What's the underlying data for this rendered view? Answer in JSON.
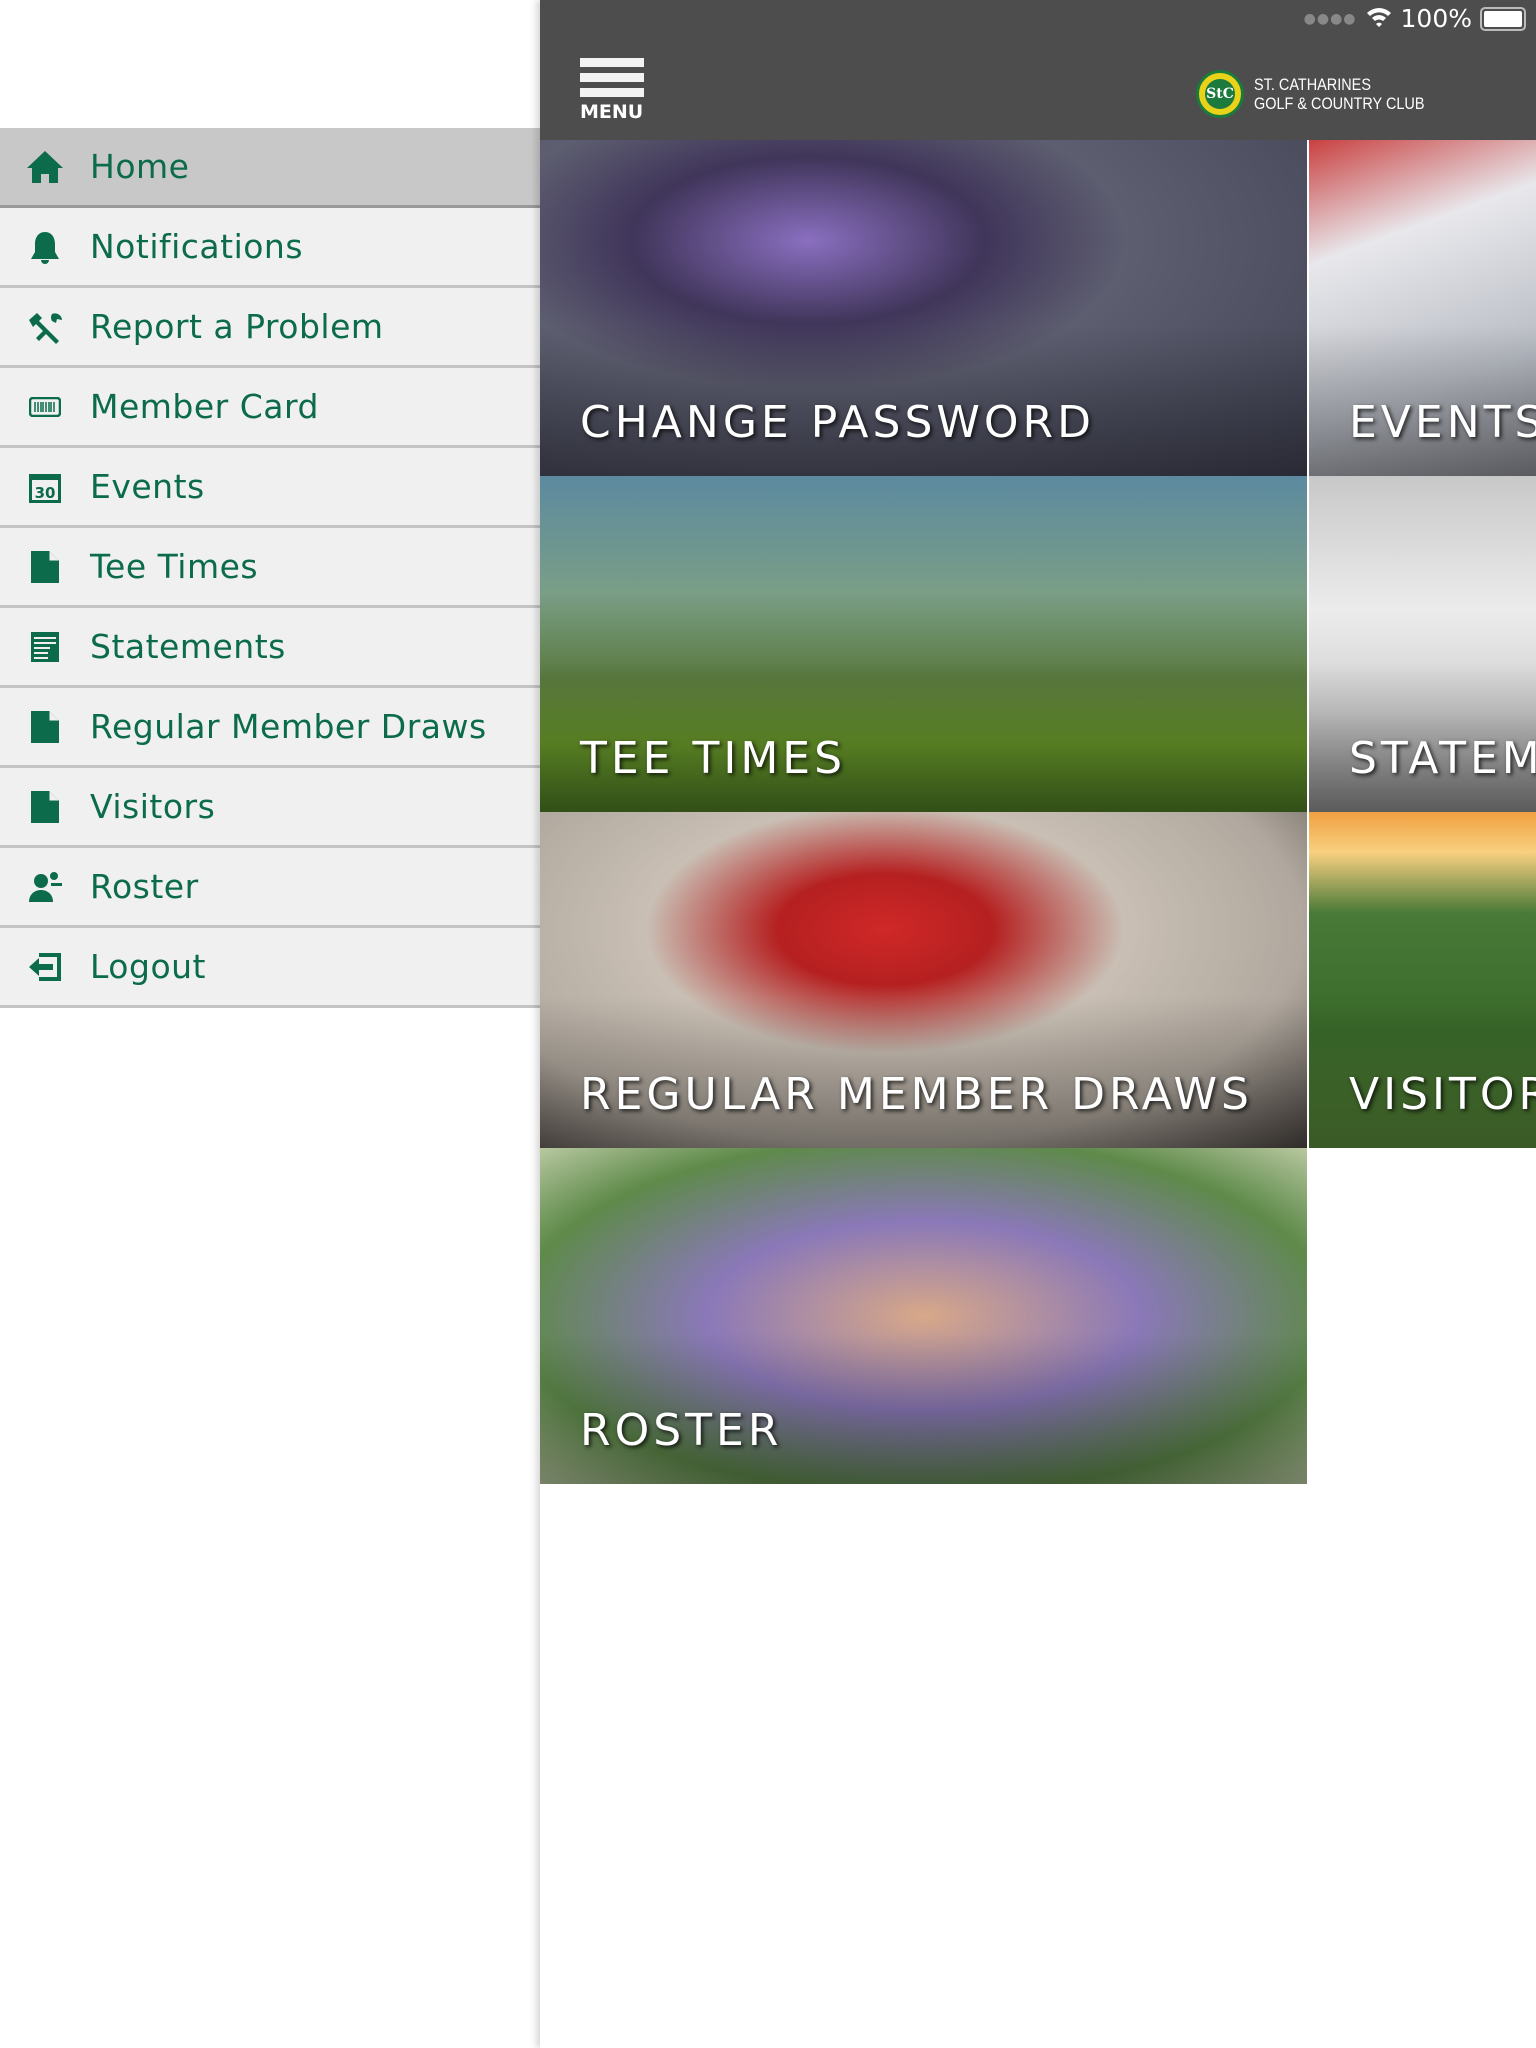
{
  "status_bar": {
    "battery": "100%",
    "battery_level": 1.0
  },
  "header": {
    "menu_label": "MENU",
    "logo_text_line1": "ST. CATHARINES",
    "logo_text_line2": "GOLF & COUNTRY CLUB",
    "logo_monogram": "StC"
  },
  "sidebar": {
    "items": [
      {
        "label": "Home",
        "icon": "home-icon",
        "active": true
      },
      {
        "label": "Notifications",
        "icon": "bell-icon"
      },
      {
        "label": "Report a Problem",
        "icon": "tools-icon"
      },
      {
        "label": "Member Card",
        "icon": "barcode-card-icon"
      },
      {
        "label": "Events",
        "icon": "calendar-icon",
        "icon_text": "30"
      },
      {
        "label": "Tee Times",
        "icon": "document-icon"
      },
      {
        "label": "Statements",
        "icon": "statement-icon"
      },
      {
        "label": "Regular Member Draws",
        "icon": "document-icon"
      },
      {
        "label": "Visitors",
        "icon": "document-icon"
      },
      {
        "label": "Roster",
        "icon": "person-icon"
      },
      {
        "label": "Logout",
        "icon": "logout-icon"
      }
    ]
  },
  "tiles": [
    {
      "label": "CHANGE PASSWORD"
    },
    {
      "label": "EVENTS"
    },
    {
      "label": "TEE TIMES"
    },
    {
      "label": "STATEMENTS"
    },
    {
      "label": "REGULAR MEMBER DRAWS"
    },
    {
      "label": "VISITORS"
    },
    {
      "label": "ROSTER"
    }
  ],
  "colors": {
    "accent": "#0b6b4a",
    "header": "#4d4d4d",
    "sidebar": "#f0f0f0",
    "active": "#c9c8c9"
  }
}
